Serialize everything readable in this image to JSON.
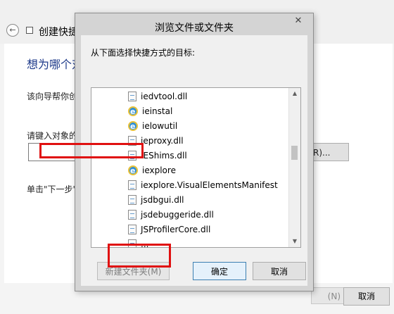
{
  "wizard": {
    "back_glyph": "←",
    "title": "创建快捷",
    "heading": "想为哪个对",
    "description": "该向导帮你创",
    "field_label": "请键入对象的化",
    "browse_label": "R)...",
    "hint": "单击\"下一步\"继",
    "next_label": "(N)",
    "cancel_label": "取消"
  },
  "dialog": {
    "title": "浏览文件或文件夹",
    "close_glyph": "✕",
    "instruction": "从下面选择快捷方式的目标:",
    "items": [
      {
        "name": "iedvtool.dll",
        "icon": "dll-file-icon"
      },
      {
        "name": "ieinstal",
        "icon": "ie-icon"
      },
      {
        "name": "ielowutil",
        "icon": "ie-icon"
      },
      {
        "name": "ieproxy.dll",
        "icon": "dll-file-icon"
      },
      {
        "name": "IEShims.dll",
        "icon": "dll-file-icon"
      },
      {
        "name": "iexplore",
        "icon": "ie-icon"
      },
      {
        "name": "iexplore.VisualElementsManifest",
        "icon": "dll-file-icon"
      },
      {
        "name": "jsdbgui.dll",
        "icon": "dll-file-icon"
      },
      {
        "name": "jsdebuggeride.dll",
        "icon": "dll-file-icon"
      },
      {
        "name": "JSProfilerCore.dll",
        "icon": "dll-file-icon"
      },
      {
        "name": "...",
        "icon": "dll-file-icon"
      }
    ],
    "scroll_up": "▲",
    "scroll_down": "▼",
    "new_folder_label": "新建文件夹(M)",
    "ok_label": "确定",
    "cancel_label": "取消"
  },
  "colors": {
    "highlight": "#e01010",
    "heading": "#1e3a8a"
  }
}
